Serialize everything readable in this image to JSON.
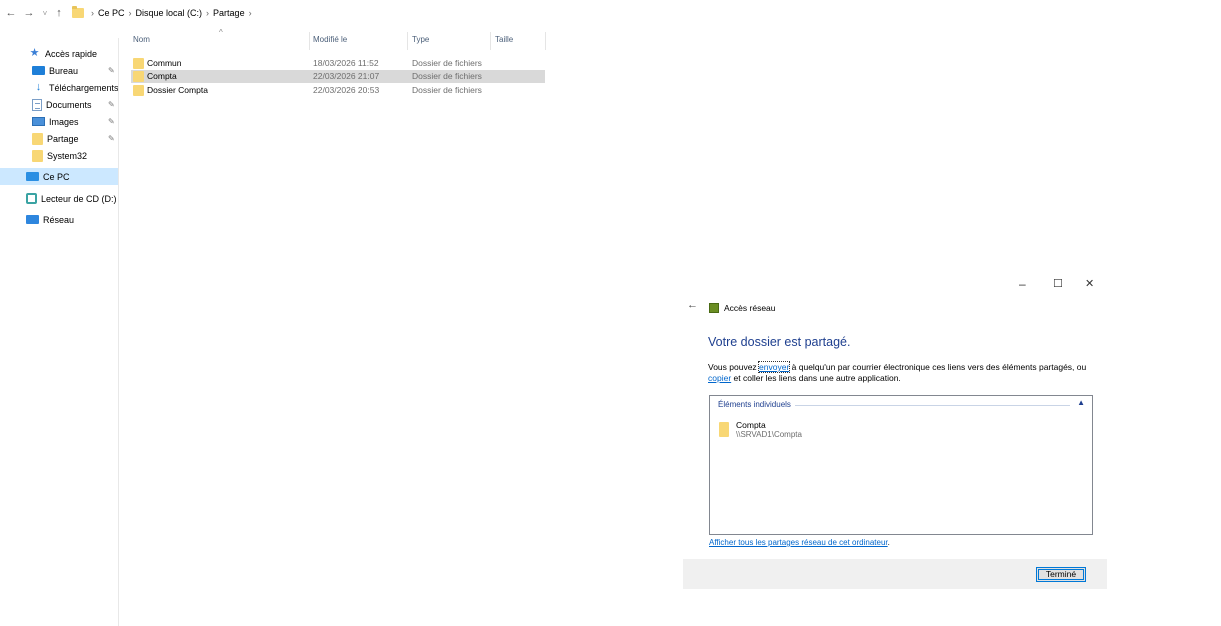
{
  "address_bar": {
    "back": "←",
    "forward": "→",
    "recent": "˅",
    "up": "↑",
    "separator": "›",
    "crumbs": [
      "Ce PC",
      "Disque local (C:)",
      "Partage"
    ]
  },
  "sidebar": {
    "items": [
      {
        "label": "Accès rapide",
        "icon": "star-icon"
      },
      {
        "label": "Bureau",
        "icon": "desktop-icon",
        "pinned": true
      },
      {
        "label": "Téléchargements",
        "icon": "download-icon",
        "pinned": true
      },
      {
        "label": "Documents",
        "icon": "documents-icon",
        "pinned": true
      },
      {
        "label": "Images",
        "icon": "pictures-icon",
        "pinned": true
      },
      {
        "label": "Partage",
        "icon": "folder-icon",
        "pinned": true
      },
      {
        "label": "System32",
        "icon": "folder-icon"
      },
      {
        "label": "Ce PC",
        "icon": "computer-icon",
        "selected": true
      },
      {
        "label": "Lecteur de CD (D:) Vi",
        "icon": "cd-drive-icon"
      },
      {
        "label": "Réseau",
        "icon": "network-icon"
      }
    ],
    "pin_glyph": "📌"
  },
  "file_list": {
    "columns": [
      "Nom",
      "Modifié le",
      "Type",
      "Taille"
    ],
    "sort_glyph": "^",
    "rows": [
      {
        "name": "Commun",
        "modified": "18/03/2026 11:52",
        "type": "Dossier de fichiers",
        "size": ""
      },
      {
        "name": "Compta",
        "modified": "22/03/2026 21:07",
        "type": "Dossier de fichiers",
        "size": "",
        "selected": true
      },
      {
        "name": "Dossier Compta",
        "modified": "22/03/2026 20:53",
        "type": "Dossier de fichiers",
        "size": ""
      }
    ]
  },
  "dialog": {
    "minimize": "–",
    "maximize": "☐",
    "close": "✕",
    "back": "←",
    "title": "Accès réseau",
    "heading": "Votre dossier est partagé.",
    "text_part1": "Vous pouvez ",
    "link_send": "envoyer",
    "text_part2": " à quelqu'un par courrier électronique ces liens vers des éléments partagés, ou ",
    "link_copy": "copier",
    "text_part3": " et coller les liens dans une autre application.",
    "group_header": "Éléments individuels",
    "group_caret": "▲",
    "share_name": "Compta",
    "share_path": "\\\\SRVAD1\\Compta",
    "all_shares_link": "Afficher tous les partages réseau de cet ordinateur",
    "all_shares_period": ".",
    "done_button": "Terminé"
  },
  "colors": {
    "selection_sidebar": "#cce8ff",
    "selection_row": "#d9d9d9",
    "heading_blue": "#1e3f8f",
    "link_blue": "#0066cc",
    "folder_yellow": "#f8d775"
  }
}
